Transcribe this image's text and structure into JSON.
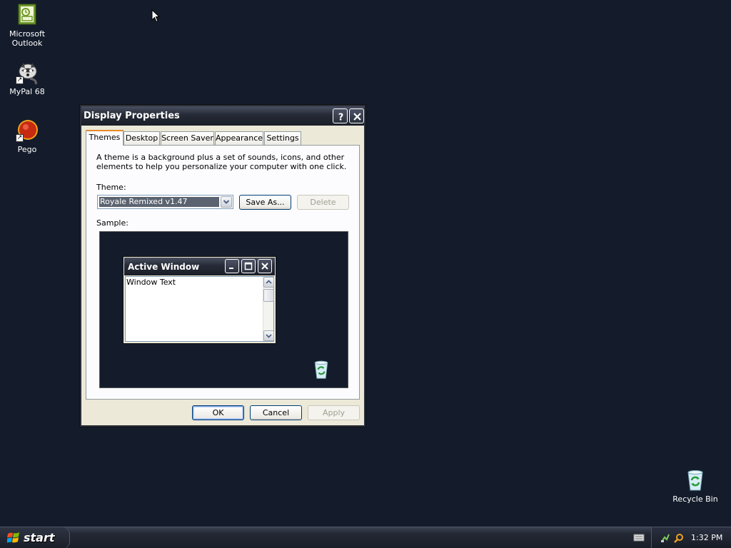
{
  "desktop": {
    "icons": [
      {
        "label": "Microsoft\nOutlook",
        "icon": "outlook-icon"
      },
      {
        "label": "MyPal 68",
        "icon": "mypal-icon"
      },
      {
        "label": "Pego",
        "icon": "pego-icon"
      },
      {
        "label": "Recycle Bin",
        "icon": "recycle-bin-icon"
      }
    ]
  },
  "dialog": {
    "title": "Display Properties",
    "tabs": [
      {
        "label": "Themes",
        "active": true
      },
      {
        "label": "Desktop"
      },
      {
        "label": "Screen Saver"
      },
      {
        "label": "Appearance"
      },
      {
        "label": "Settings"
      }
    ],
    "description": "A theme is a background plus a set of sounds, icons, and other elements to help you personalize your computer with one click.",
    "theme_label": "Theme:",
    "theme_value": "Royale Remixed v1.47",
    "save_as_label": "Save As...",
    "delete_label": "Delete",
    "sample_label": "Sample:",
    "sample": {
      "window_title": "Active Window",
      "window_text": "Window Text"
    },
    "ok_label": "OK",
    "cancel_label": "Cancel",
    "apply_label": "Apply"
  },
  "taskbar": {
    "start_label": "start",
    "clock": "1:32 PM"
  },
  "colors": {
    "desktop_bg": "#141c2b",
    "dialog_face": "#ece9d8",
    "tab_highlight": "#e68b2c"
  }
}
